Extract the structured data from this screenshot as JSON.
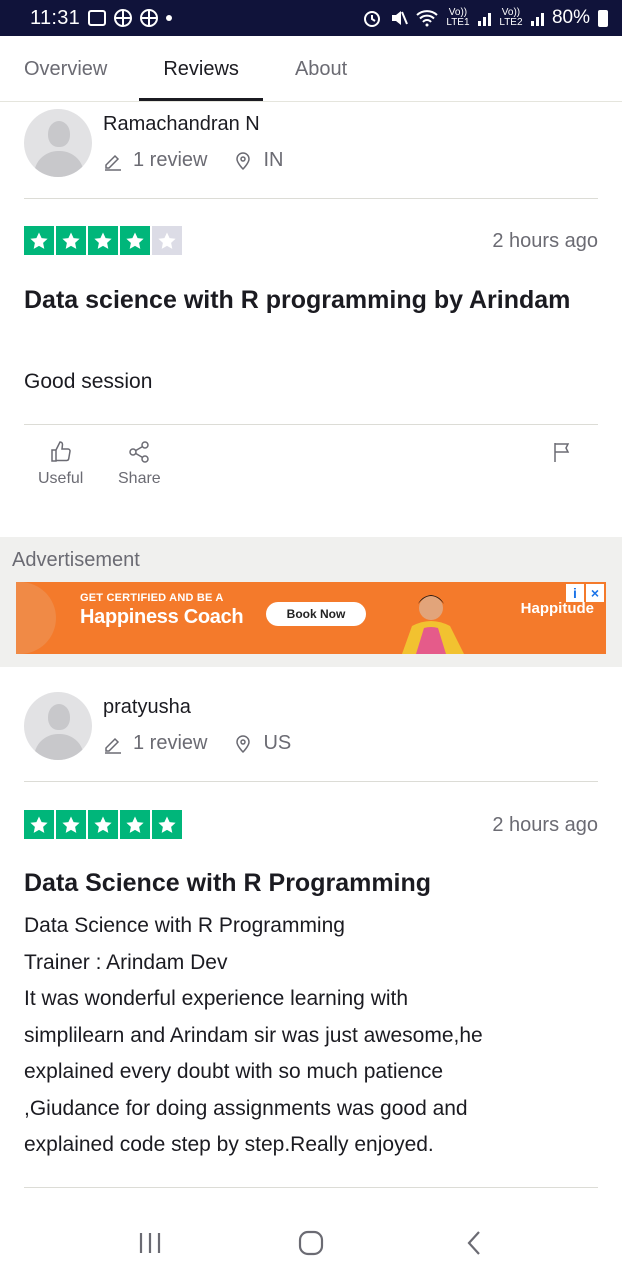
{
  "status_bar": {
    "time": "11:31",
    "battery": "80%",
    "sim1": "Vo)) LTE1",
    "sim2": "Vo)) LTE2"
  },
  "tabs": [
    {
      "label": "Overview",
      "active": false
    },
    {
      "label": "Reviews",
      "active": true
    },
    {
      "label": "About",
      "active": false
    }
  ],
  "reviews": [
    {
      "reviewer": "Ramachandran N",
      "review_count": "1 review",
      "country": "IN",
      "rating": 4,
      "date": "2 hours ago",
      "title": "Data science with R programming by Arindam",
      "body": [
        "Good session"
      ],
      "actions": {
        "useful": "Useful",
        "share": "Share"
      }
    },
    {
      "reviewer": "pratyusha",
      "review_count": "1 review",
      "country": "US",
      "rating": 5,
      "date": "2 hours ago",
      "title": "Data Science with R Programming",
      "body": [
        "Data Science with R Programming",
        "Trainer : Arindam Dev",
        "It was wonderful experience learning with",
        "simplilearn and Arindam sir was just awesome,he",
        "explained every doubt with so much patience",
        ",Giudance for doing assignments was good and",
        "explained code step by step.Really enjoyed."
      ]
    }
  ],
  "advertisement": {
    "label": "Advertisement",
    "headline_small": "GET CERTIFIED AND BE A",
    "headline_big": "Happiness Coach",
    "cta": "Book Now",
    "brand": "Happitude",
    "colors": {
      "banner": "#f47a2b"
    }
  },
  "colors": {
    "star_green": "#00b67a",
    "star_off": "#dcdce6",
    "status_bar": "#10133a"
  }
}
